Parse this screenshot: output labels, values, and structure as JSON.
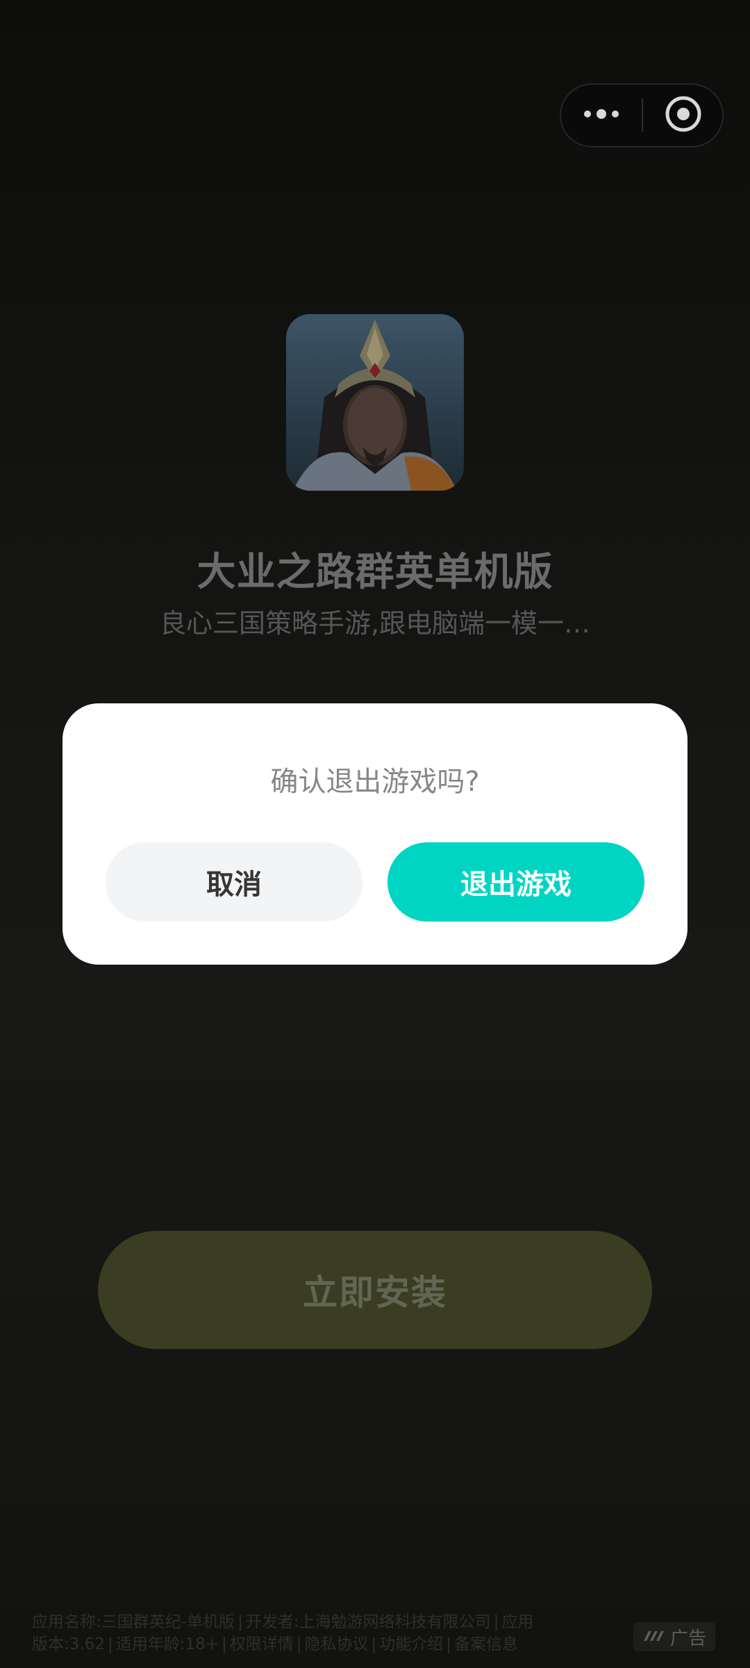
{
  "capsule": {
    "more_icon": "more-dots-icon",
    "close_icon": "close-target-icon"
  },
  "app": {
    "icon": "game-hero-portrait",
    "title": "大业之路群英单机版",
    "description": "良心三国策略手游,跟电脑端一模一…"
  },
  "install": {
    "label": "立即安装",
    "color": "#3b3d22"
  },
  "dialog": {
    "title": "确认退出游戏吗?",
    "cancel_label": "取消",
    "exit_label": "退出游戏",
    "accent": "#00d5c3"
  },
  "footer": {
    "app_name": "应用名称:三国群英纪-单机版",
    "developer": "开发者:上海勉游网络科技有限公司",
    "version_prefix": "应用",
    "version": "版本:3.62",
    "age": "适用年龄:18+",
    "permissions": "权限详情",
    "privacy": "隐私协议",
    "features": "功能介绍",
    "filing": "备案信息",
    "ad_label": "广告"
  }
}
